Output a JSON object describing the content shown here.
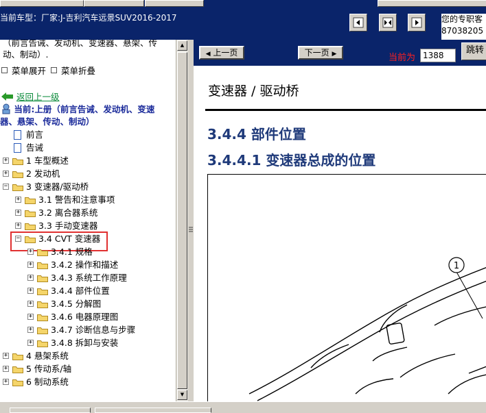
{
  "header": {
    "vehicle_label": "当前车型：厂家:J-吉利汽车远景SUV2016-2017",
    "service_line1": "您的专职客",
    "service_line2": "87038205"
  },
  "sidebar": {
    "cropped_title_line1": "（前言告诫、发动机、变速器、悬架、传",
    "cropped_title_line2": "动、制动）.",
    "expand_label": "菜单展开",
    "collapse_label": "菜单折叠",
    "back_label": "返回上一级",
    "current_line1": "当前:上册（前言告诫、发动机、变速",
    "current_line2": "器、悬架、传动、制动）",
    "items": [
      {
        "label": "前言"
      },
      {
        "label": "告诫"
      },
      {
        "label": "1 车型概述"
      },
      {
        "label": "2 发动机"
      },
      {
        "label": "3 变速器/驱动桥"
      },
      {
        "label": "3.1 警告和注意事项"
      },
      {
        "label": "3.2 离合器系统"
      },
      {
        "label": "3.3 手动变速器"
      },
      {
        "label": "3.4 CVT 变速器"
      },
      {
        "label": "3.4.1 规格"
      },
      {
        "label": "3.4.2 操作和描述"
      },
      {
        "label": "3.4.3 系统工作原理"
      },
      {
        "label": "3.4.4 部件位置"
      },
      {
        "label": "3.4.5 分解图"
      },
      {
        "label": "3.4.6 电器原理图"
      },
      {
        "label": "3.4.7 诊断信息与步骤"
      },
      {
        "label": "3.4.8 拆卸与安装"
      },
      {
        "label": "4 悬架系统"
      },
      {
        "label": "5 传动系/轴"
      },
      {
        "label": "6 制动系统"
      }
    ],
    "highlight_color": "#e03030"
  },
  "pager": {
    "prev_label": "上一页",
    "next_label": "下一页",
    "current_label": "当前为",
    "page_value": "1388",
    "jump_label": "跳转"
  },
  "document": {
    "title": "变速器 / 驱动桥",
    "section": "3.4.4 部件位置",
    "subsection": "3.4.4.1 变速器总成的位置",
    "callout": "1"
  },
  "colors": {
    "bar_blue": "#0a246a",
    "heading_blue": "#1f3a7a",
    "page_label_red": "#ff2020"
  }
}
